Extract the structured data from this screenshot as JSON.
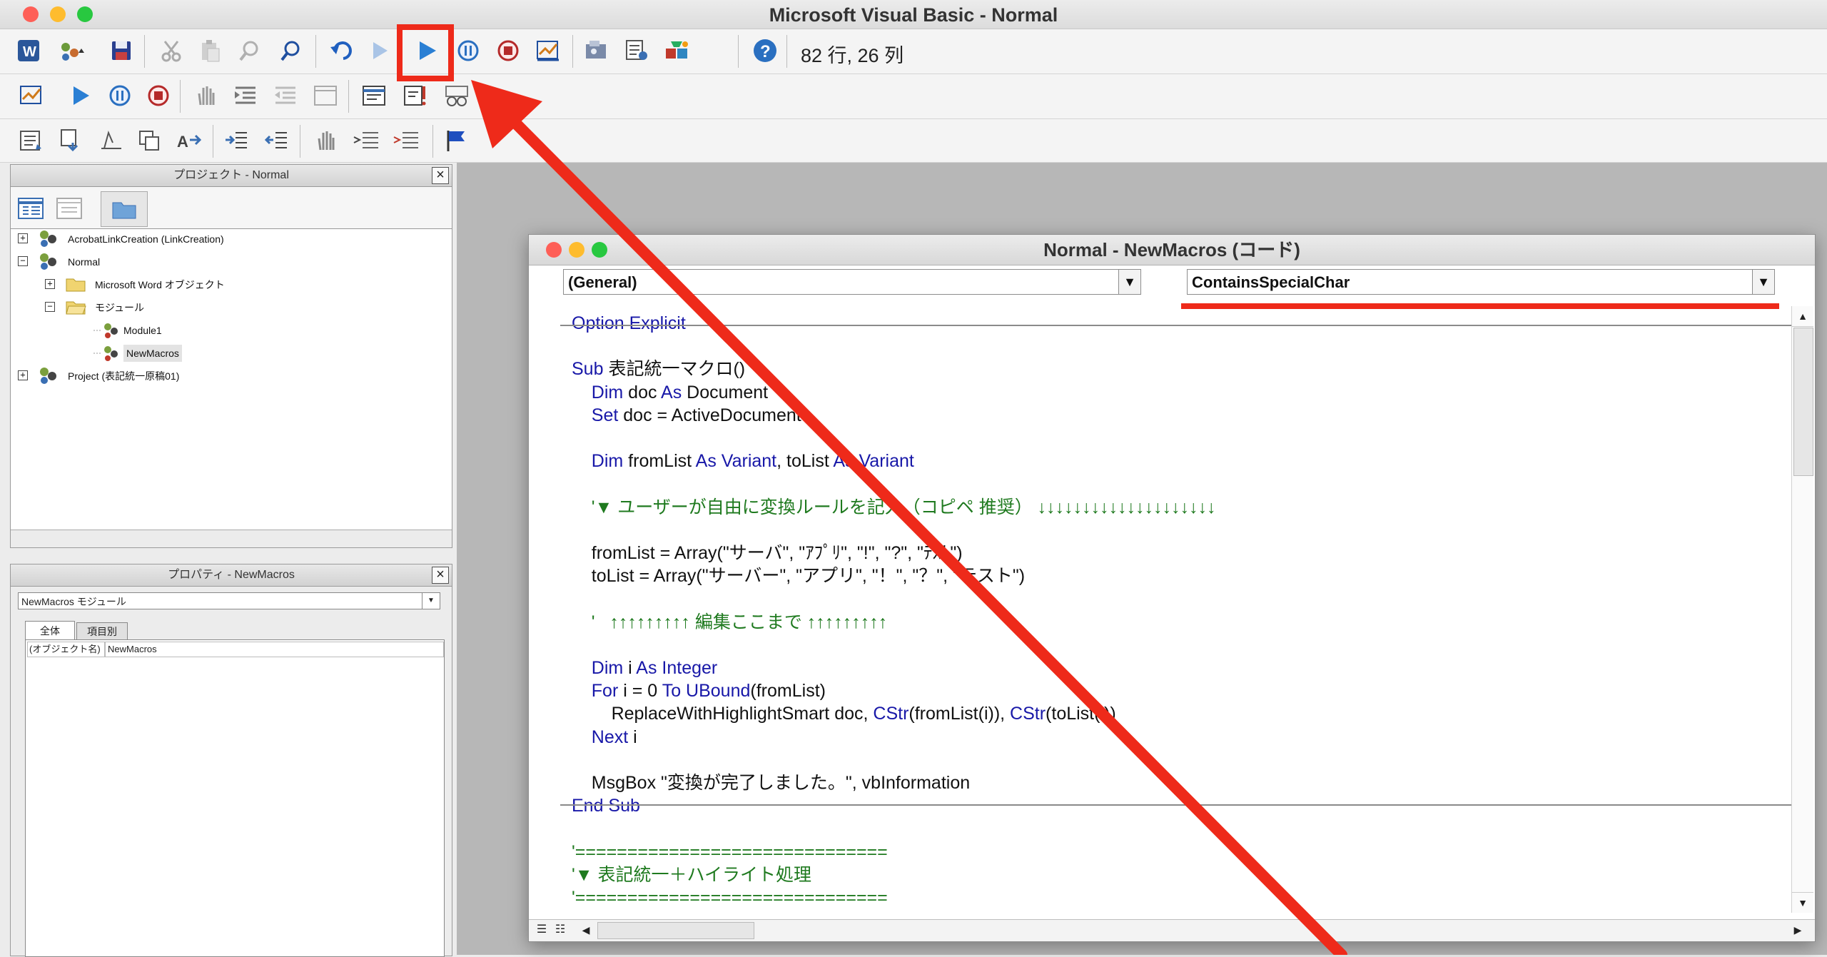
{
  "window": {
    "title": "Microsoft Visual Basic - Normal"
  },
  "toolbar": {
    "cursor_position": "82 行, 26 列"
  },
  "project_panel": {
    "title": "プロジェクト - Normal",
    "tree": [
      {
        "label": "AcrobatLinkCreation (LinkCreation)",
        "expander": "+"
      },
      {
        "label": "Normal",
        "expander": "−"
      },
      {
        "label": "Microsoft Word オブジェクト",
        "expander": "+"
      },
      {
        "label": "モジュール",
        "expander": "−"
      },
      {
        "label": "Module1"
      },
      {
        "label": "NewMacros"
      },
      {
        "label": "Project (表記統一原稿01)",
        "expander": "+"
      }
    ]
  },
  "properties_panel": {
    "title": "プロパティ - NewMacros",
    "selector": "NewMacros  モジュール",
    "tabs": [
      "全体",
      "項目別"
    ],
    "row": {
      "name": "(オブジェクト名)",
      "value": "NewMacros"
    }
  },
  "code_window": {
    "title": "Normal - NewMacros (コード)",
    "object_combo": "(General)",
    "procedure_combo": "ContainsSpecialChar"
  },
  "code_lines": {
    "l0": [
      [
        "Option Explicit",
        "kw"
      ]
    ],
    "l2": [
      [
        "Sub ",
        "kw"
      ],
      [
        "表記統一マクロ()",
        "tx"
      ]
    ],
    "l3": [
      [
        "    Dim ",
        "kw"
      ],
      [
        "doc ",
        "tx"
      ],
      [
        "As ",
        "kw"
      ],
      [
        "Document",
        "tx"
      ]
    ],
    "l4": [
      [
        "    Set ",
        "kw"
      ],
      [
        "doc = ActiveDocument",
        "tx"
      ]
    ],
    "l6": [
      [
        "    Dim ",
        "kw"
      ],
      [
        "fromList ",
        "tx"
      ],
      [
        "As Variant",
        "kw"
      ],
      [
        ", toList ",
        "tx"
      ],
      [
        "As Variant",
        "kw"
      ]
    ],
    "l8": [
      [
        "    '▼ ユーザーが自由に変換ルールを記入（コピペ 推奨） ↓↓↓↓↓↓↓↓↓↓↓↓↓↓↓↓↓↓↓↓",
        "cm"
      ]
    ],
    "l10": [
      [
        "    fromList = Array(\"サーバ\", \"ｱﾌﾟﾘ\", \"!\", \"?\", \"ﾃｽﾄ\")",
        "tx"
      ]
    ],
    "l11": [
      [
        "    toList = Array(\"サーバー\", \"アプリ\", \"！\", \"？\", \"テスト\")",
        "tx"
      ]
    ],
    "l13": [
      [
        "    '   ↑↑↑↑↑↑↑↑↑ 編集ここまで ↑↑↑↑↑↑↑↑↑",
        "cm"
      ]
    ],
    "l15": [
      [
        "    Dim ",
        "kw"
      ],
      [
        "i ",
        "tx"
      ],
      [
        "As Integer",
        "kw"
      ]
    ],
    "l16": [
      [
        "    For ",
        "kw"
      ],
      [
        "i = 0 ",
        "tx"
      ],
      [
        "To ",
        "kw"
      ],
      [
        "UBound",
        "kw"
      ],
      [
        "(fromList)",
        "tx"
      ]
    ],
    "l17": [
      [
        "        ReplaceWithHighlightSmart doc, ",
        "tx"
      ],
      [
        "CStr",
        "kw"
      ],
      [
        "(fromList(i)), ",
        "tx"
      ],
      [
        "CStr",
        "kw"
      ],
      [
        "(toList(i))",
        "tx"
      ]
    ],
    "l18": [
      [
        "    Next ",
        "kw"
      ],
      [
        "i",
        "tx"
      ]
    ],
    "l20": [
      [
        "    MsgBox \"変換が完了しました。\", vbInformation",
        "tx"
      ]
    ],
    "l21": [
      [
        "End Sub",
        "kw"
      ]
    ],
    "l23": [
      [
        "'==============================",
        "cm"
      ]
    ],
    "l24": [
      [
        "'▼ 表記統一＋ハイライト処理",
        "cm"
      ]
    ],
    "l25": [
      [
        "'==============================",
        "cm"
      ]
    ]
  },
  "colors": {
    "annotation": "#ee2a1a",
    "keyword": "#1818a8",
    "comment": "#1f7a1f",
    "run": "#2a7fd4"
  }
}
